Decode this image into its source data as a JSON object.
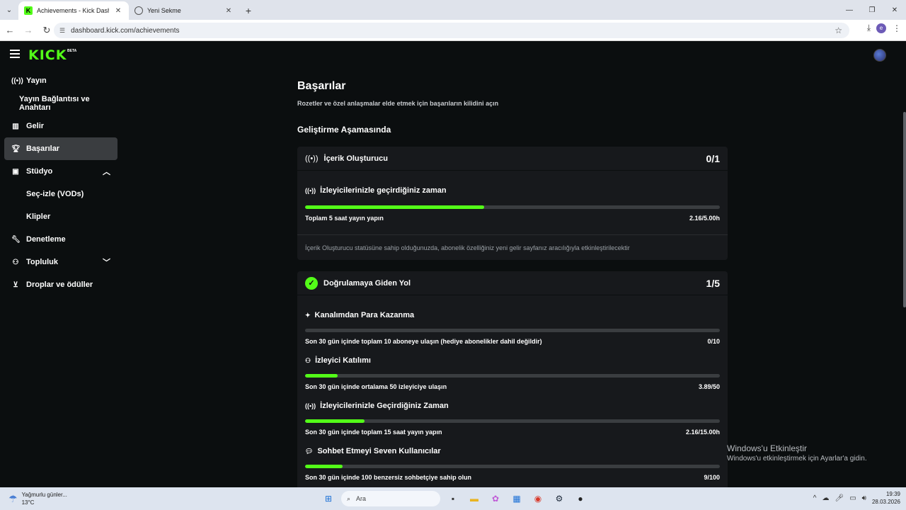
{
  "browser": {
    "tabs": [
      {
        "title": "Achievements - Kick Dashboard",
        "active": true
      },
      {
        "title": "Yeni Sekme",
        "active": false
      }
    ],
    "url": "dashboard.kick.com/achievements",
    "profile_initial": "e"
  },
  "app": {
    "logo": "KICK",
    "logo_tag": "BETA"
  },
  "sidebar": {
    "items": [
      {
        "label": "Yayın",
        "icon": "broadcast-icon"
      },
      {
        "label": "Yayın Bağlantısı ve Anahtarı"
      },
      {
        "label": "Gelir",
        "icon": "chart-icon"
      },
      {
        "label": "Başarılar",
        "icon": "trophy-icon",
        "active": true
      },
      {
        "label": "Stüdyo",
        "icon": "studio-icon",
        "expanded": true
      },
      {
        "label": "Seç-izle (VODs)"
      },
      {
        "label": "Klipler"
      },
      {
        "label": "Denetleme",
        "icon": "wrench-icon"
      },
      {
        "label": "Topluluk",
        "icon": "community-icon",
        "expanded": false
      },
      {
        "label": "Droplar ve ödüller",
        "icon": "drops-icon"
      }
    ]
  },
  "main": {
    "title": "Başarılar",
    "subtitle": "Rozetler ve özel anlaşmalar elde etmek için başarıların kilidini açın",
    "section": "Geliştirme Aşamasında",
    "cards": [
      {
        "title": "İçerik Oluşturucu",
        "count": "0/1",
        "achievements": [
          {
            "title": "İzleyicilerinizle geçirdiğiniz zaman",
            "desc": "Toplam 5 saat yayın yapın",
            "value": "2.16/5.00h",
            "progress": 0.432
          }
        ],
        "note": "İçerik Oluşturucu statüsüne sahip olduğunuzda, abonelik özelliğiniz yeni gelir sayfanız aracılığıyla etkinleştirilecektir"
      },
      {
        "title": "Doğrulamaya Giden Yol",
        "count": "1/5",
        "achievements": [
          {
            "title": "Kanalımdan Para Kazanma",
            "desc": "Son 30 gün içinde toplam 10 aboneye ulaşın (hediye abonelikler dahil değildir)",
            "value": "0/10",
            "progress": 0.0
          },
          {
            "title": "İzleyici Katılımı",
            "desc": "Son 30 gün içinde ortalama 50 izleyiciye ulaşın",
            "value": "3.89/50",
            "progress": 0.078
          },
          {
            "title": "İzleyicilerinizle Geçirdiğiniz Zaman",
            "desc": "Son 30 gün içinde toplam 15 saat yayın yapın",
            "value": "2.16/15.00h",
            "progress": 0.144
          },
          {
            "title": "Sohbet Etmeyi Seven Kullanıcılar",
            "desc": "Son 30 gün içinde 100 benzersiz sohbetçiye sahip olun",
            "value": "9/100",
            "progress": 0.09
          }
        ]
      }
    ]
  },
  "watermark": {
    "line1": "Windows'u Etkinleştir",
    "line2": "Windows'u etkinleştirmek için Ayarlar'a gidin."
  },
  "taskbar": {
    "weather_text": "Yağmurlu günler...",
    "temperature": "13°C",
    "search_placeholder": "Ara",
    "time": "19:39",
    "date": "28.03.2026"
  },
  "colors": {
    "accent": "#53fc18",
    "background": "#0b0e0f",
    "card": "#17191c",
    "track": "#3a3d40"
  }
}
